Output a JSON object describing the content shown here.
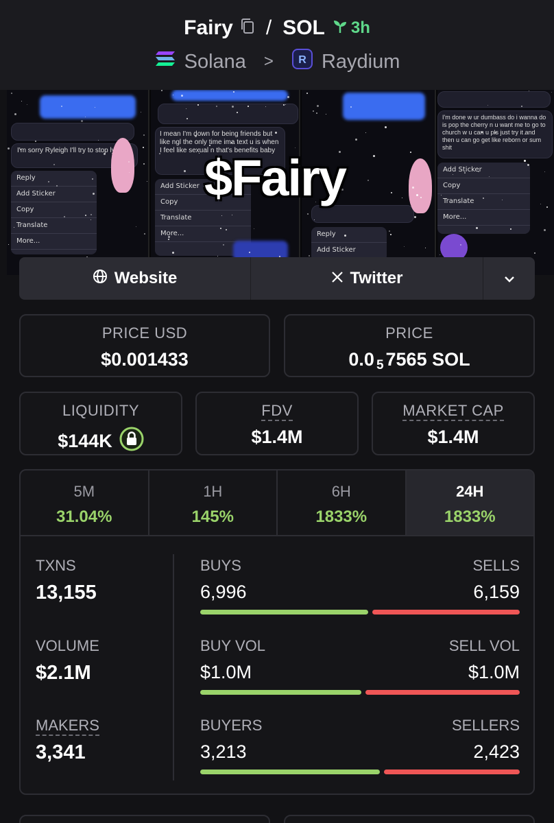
{
  "header": {
    "token": "Fairy",
    "quote": "SOL",
    "age": "3h",
    "chain": "Solana",
    "dex": "Raydium"
  },
  "banner": {
    "title": "$Fairy",
    "menu_left": [
      "Reply",
      "Add Sticker",
      "Copy",
      "Translate",
      "More..."
    ],
    "menu_mid": [
      "Add Sticker",
      "Copy",
      "Translate",
      "More..."
    ],
    "menu_right": [
      "Add Sticker",
      "Copy",
      "Translate",
      "More..."
    ],
    "chat_left": "I'm sorry Ryleigh I'll try to stop lying",
    "chat_mid": "I mean I'm down for being friends but like ngl the only time ima text u is when I feel like sexual n that's benefits baby",
    "chat_right": "I'm done w ur dumbass do i wanna do is pop the cherry n u want me to go to church w u can u pls just try it and then u can go get like reborn or sum shit"
  },
  "links": {
    "website": "Website",
    "twitter": "Twitter"
  },
  "price": {
    "usd_label": "PRICE USD",
    "usd_value": "$0.001433",
    "native_label": "PRICE",
    "native_prefix": "0.0",
    "native_zeros": "5",
    "native_digits": "7565 SOL"
  },
  "metrics": {
    "liquidity_label": "LIQUIDITY",
    "liquidity_value": "$144K",
    "fdv_label": "FDV",
    "fdv_value": "$1.4M",
    "mcap_label": "MARKET CAP",
    "mcap_value": "$1.4M"
  },
  "tabs": [
    {
      "label": "5M",
      "value": "31.04%"
    },
    {
      "label": "1H",
      "value": "145%"
    },
    {
      "label": "6H",
      "value": "1833%"
    },
    {
      "label": "24H",
      "value": "1833%"
    }
  ],
  "stats": {
    "txns_label": "TXNS",
    "txns_value": "13,155",
    "volume_label": "VOLUME",
    "volume_value": "$2.1M",
    "makers_label": "MAKERS",
    "makers_value": "3,341",
    "buys_label": "BUYS",
    "buys_value": "6,996",
    "sells_label": "SELLS",
    "sells_value": "6,159",
    "buyvol_label": "BUY VOL",
    "buyvol_value": "$1.0M",
    "sellvol_label": "SELL VOL",
    "sellvol_value": "$1.0M",
    "buyers_label": "BUYERS",
    "buyers_value": "3,213",
    "sellers_label": "SELLERS",
    "sellers_value": "2,423",
    "buys_share": 0.532,
    "buyvol_share": 0.51,
    "buyers_share": 0.57
  },
  "colors": {
    "green": "#9ad36a",
    "red": "#ef5656",
    "age_green": "#5fd88a"
  }
}
